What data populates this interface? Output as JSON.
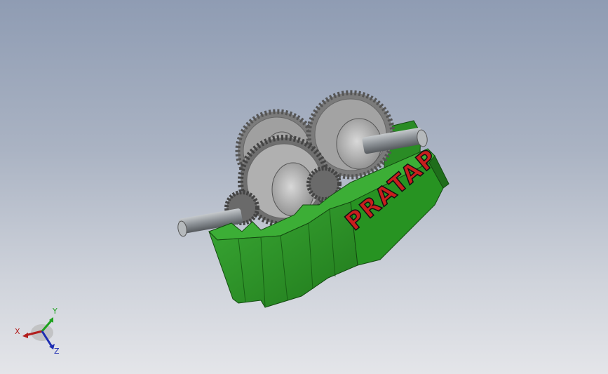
{
  "viewport": {
    "background_top": "#8f9cb3",
    "background_bottom": "#e4e5e9"
  },
  "model": {
    "housing_color": "#2f9a2a",
    "housing_dark": "#1f6e1b",
    "lettering_color": "#c81e1e",
    "engraved_text": "PRATAP",
    "gear_color": "#9a9a9a",
    "shaft_color": "#8a8f94"
  },
  "triad": {
    "x_label": "X",
    "y_label": "Y",
    "z_label": "Z",
    "x_color": "#b21e1e",
    "y_color": "#1ea21e",
    "z_color": "#1e2eb2"
  }
}
